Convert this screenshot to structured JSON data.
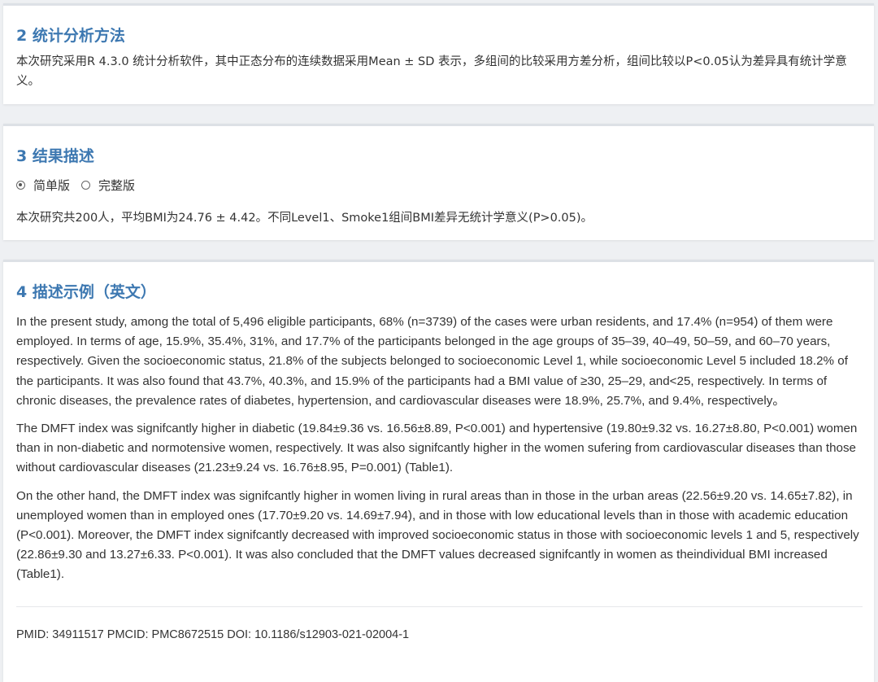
{
  "section2": {
    "title": "2 统计分析方法",
    "text": "本次研究采用R 4.3.0 统计分析软件，其中正态分布的连续数据采用Mean ± SD 表示，多组间的比较采用方差分析，组间比较以P<0.05认为差异具有统计学意义。"
  },
  "section3": {
    "title": "3 结果描述",
    "radio_options": [
      {
        "label": "简单版",
        "checked": true
      },
      {
        "label": "完整版",
        "checked": false
      }
    ],
    "text": "本次研究共200人，平均BMI为24.76 ± 4.42。不同Level1、Smoke1组间BMI差异无统计学意义(P>0.05)。"
  },
  "section4": {
    "title": "4 描述示例（英文）",
    "paragraphs": [
      "In the present study, among the total of 5,496 eligible participants, 68% (n=3739) of the cases were urban residents, and 17.4% (n=954) of them were employed. In terms of age, 15.9%, 35.4%, 31%, and 17.7% of the participants belonged in the age groups of 35–39, 40–49, 50–59, and 60–70 years, respectively. Given the socioeconomic status, 21.8% of the subjects belonged to socioeconomic Level 1, while socioeconomic Level 5 included 18.2% of the participants. It was also found that 43.7%, 40.3%, and 15.9% of the participants had a BMI value of ≥30, 25–29, and<25, respectively. In terms of chronic diseases, the prevalence rates of diabetes, hypertension, and cardiovascular diseases were 18.9%, 25.7%, and 9.4%, respectively。",
      "The DMFT index was signifcantly higher in diabetic (19.84±9.36 vs. 16.56±8.89, P<0.001) and hypertensive (19.80±9.32 vs. 16.27±8.80, P<0.001) women than in non-diabetic and normotensive women, respectively. It was also signifcantly higher in the women sufering from cardiovascular diseases than those without cardiovascular diseases (21.23±9.24 vs. 16.76±8.95, P=0.001) (Table1).",
      "On the other hand, the DMFT index was signifcantly higher in women living in rural areas than in those in the urban areas (22.56±9.20 vs. 14.65±7.82), in unemployed women than in employed ones (17.70±9.20 vs. 14.69±7.94), and in those with low educational levels than in those with academic education (P<0.001). Moreover, the DMFT index signifcantly decreased with improved socioeconomic status in those with socioeconomic levels 1 and 5, respectively (22.86±9.30 and 13.27±6.33. P<0.001). It was also concluded that the DMFT values decreased signifcantly in women as theindividual BMI increased (Table1)."
    ],
    "footer": "PMID: 34911517 PMCID: PMC8672515 DOI: 10.1186/s12903-021-02004-1"
  },
  "colors": {
    "title_blue": "#3d78b1",
    "background": "#eef0f3",
    "card": "#ffffff"
  }
}
